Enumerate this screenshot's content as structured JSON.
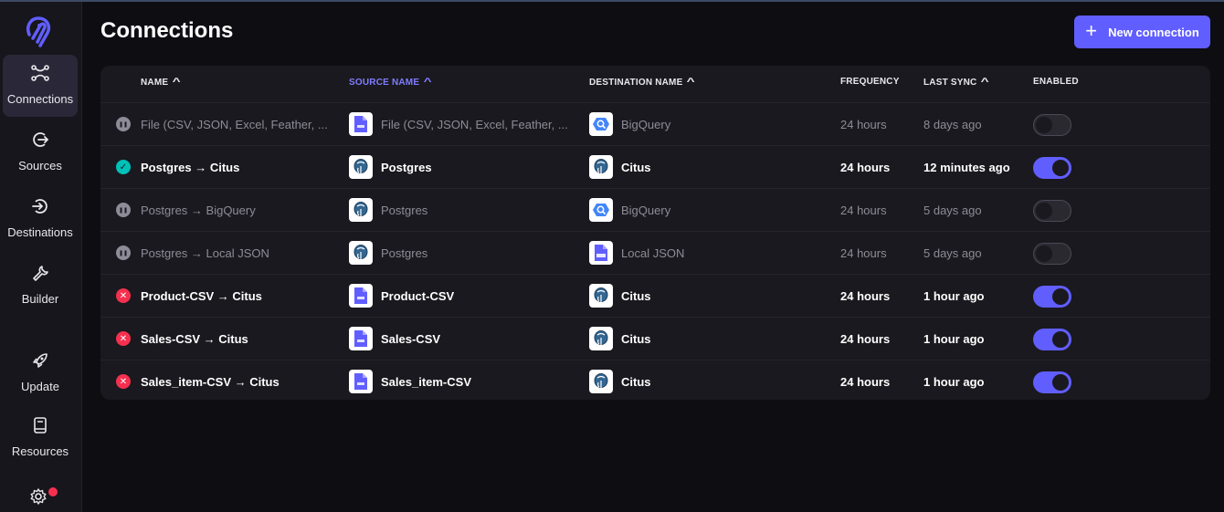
{
  "sidebar": {
    "items": [
      {
        "label": "Connections",
        "icon": "connections-icon",
        "active": true
      },
      {
        "label": "Sources",
        "icon": "sources-icon"
      },
      {
        "label": "Destinations",
        "icon": "destinations-icon"
      },
      {
        "label": "Builder",
        "icon": "wrench-icon"
      },
      {
        "label": "Update",
        "icon": "rocket-icon"
      },
      {
        "label": "Resources",
        "icon": "book-icon"
      }
    ],
    "settings_icon": "gear-icon"
  },
  "page": {
    "title": "Connections",
    "new_button": "New connection"
  },
  "table": {
    "columns": {
      "name": "NAME",
      "source": "SOURCE NAME",
      "destination": "DESTINATION NAME",
      "frequency": "FREQUENCY",
      "last_sync": "LAST SYNC",
      "enabled": "ENABLED"
    },
    "rows": [
      {
        "status": "paused",
        "name": "File (CSV, JSON, Excel, Feather, ...",
        "source": "File (CSV, JSON, Excel, Feather, ...",
        "source_icon": "file-icon",
        "destination": "BigQuery",
        "destination_icon": "bigquery-icon",
        "frequency": "24 hours",
        "last_sync": "8 days ago",
        "enabled": false
      },
      {
        "status": "ok",
        "name": "Postgres → Citus",
        "source": "Postgres",
        "source_icon": "postgres-icon",
        "destination": "Citus",
        "destination_icon": "postgres-icon",
        "frequency": "24 hours",
        "last_sync": "12 minutes ago",
        "enabled": true
      },
      {
        "status": "paused",
        "name": "Postgres → BigQuery",
        "source": "Postgres",
        "source_icon": "postgres-icon",
        "destination": "BigQuery",
        "destination_icon": "bigquery-icon",
        "frequency": "24 hours",
        "last_sync": "5 days ago",
        "enabled": false
      },
      {
        "status": "paused",
        "name": "Postgres → Local JSON",
        "source": "Postgres",
        "source_icon": "postgres-icon",
        "destination": "Local JSON",
        "destination_icon": "json-icon",
        "frequency": "24 hours",
        "last_sync": "5 days ago",
        "enabled": false
      },
      {
        "status": "error",
        "name": "Product-CSV → Citus",
        "source": "Product-CSV",
        "source_icon": "file-icon",
        "destination": "Citus",
        "destination_icon": "postgres-icon",
        "frequency": "24 hours",
        "last_sync": "1 hour ago",
        "enabled": true
      },
      {
        "status": "error",
        "name": "Sales-CSV → Citus",
        "source": "Sales-CSV",
        "source_icon": "file-icon",
        "destination": "Citus",
        "destination_icon": "postgres-icon",
        "frequency": "24 hours",
        "last_sync": "1 hour ago",
        "enabled": true
      },
      {
        "status": "error",
        "name": "Sales_item-CSV → Citus",
        "source": "Sales_item-CSV",
        "source_icon": "file-icon",
        "destination": "Citus",
        "destination_icon": "postgres-icon",
        "frequency": "24 hours",
        "last_sync": "1 hour ago",
        "enabled": true
      }
    ]
  },
  "colors": {
    "accent": "#615eff",
    "ok": "#00c1b7",
    "error": "#f5304f",
    "paused": "#8d8c97"
  }
}
